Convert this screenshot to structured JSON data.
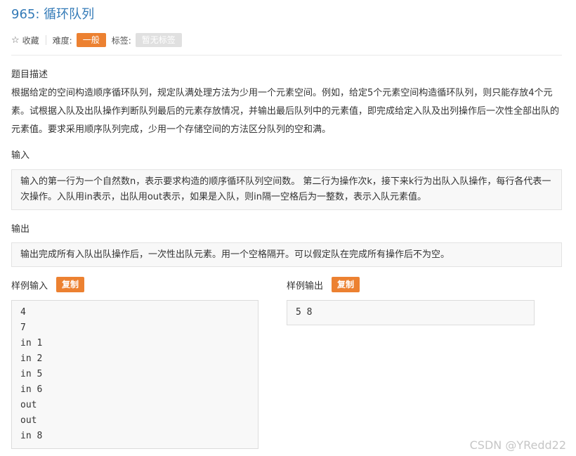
{
  "problem": {
    "title": "965: 循环队列",
    "favorite_label": "收藏",
    "difficulty_label": "难度:",
    "difficulty_value": "一般",
    "tags_label": "标签:",
    "tags_value": "暂无标签"
  },
  "description": {
    "heading": "题目描述",
    "text": "根据给定的空间构造顺序循环队列，规定队满处理方法为少用一个元素空间。例如，给定5个元素空间构造循环队列，则只能存放4个元素。试根据入队及出队操作判断队列最后的元素存放情况，并输出最后队列中的元素值，即完成给定入队及出列操作后一次性全部出队的元素值。要求采用顺序队列完成，少用一个存储空间的方法区分队列的空和满。"
  },
  "input": {
    "heading": "输入",
    "text": "输入的第一行为一个自然数n，表示要求构造的顺序循环队列空间数。 第二行为操作次k，接下来k行为出队入队操作，每行各代表一次操作。入队用in表示，出队用out表示，如果是入队，则in隔一空格后为一整数，表示入队元素值。"
  },
  "output": {
    "heading": "输出",
    "text": "输出完成所有入队出队操作后，一次性出队元素。用一个空格隔开。可以假定队在完成所有操作后不为空。"
  },
  "sample_input": {
    "heading": "样例输入",
    "copy_label": "复制",
    "lines": [
      "4",
      "7",
      "in 1",
      "in 2",
      "in 5",
      "in 6",
      "out",
      "out",
      "in 8"
    ]
  },
  "sample_output": {
    "heading": "样例输出",
    "copy_label": "复制",
    "lines": [
      "5 8"
    ]
  },
  "watermark": "CSDN @YRedd22",
  "colors": {
    "link_blue": "#337ab7",
    "accent_orange": "#ec8131",
    "tag_grey": "#e0e0e0"
  }
}
